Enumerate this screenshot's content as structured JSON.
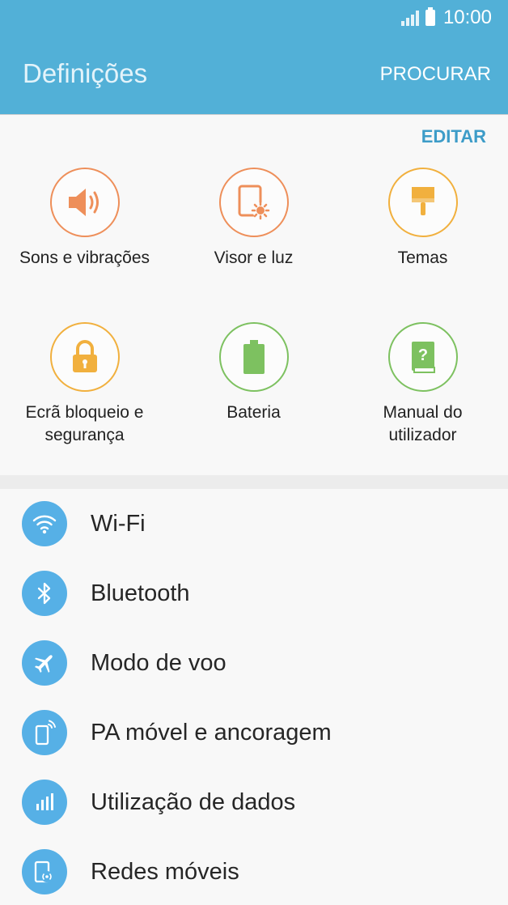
{
  "status_bar": {
    "time": "10:00"
  },
  "header": {
    "title": "Definições",
    "search_label": "PROCURAR"
  },
  "quick_settings": {
    "edit_label": "EDITAR",
    "items": [
      {
        "label": "Sons e vibrações",
        "icon": "speaker-icon",
        "color": "#ee8f5a"
      },
      {
        "label": "Visor e luz",
        "icon": "display-icon",
        "color": "#ee8f5a"
      },
      {
        "label": "Temas",
        "icon": "paintbrush-icon",
        "color": "#f1b03e"
      },
      {
        "label": "Ecrã bloqueio e segurança",
        "icon": "lock-icon",
        "color": "#f1b03e"
      },
      {
        "label": "Bateria",
        "icon": "battery-icon",
        "color": "#7dc160"
      },
      {
        "label": "Manual do utilizador",
        "icon": "manual-icon",
        "color": "#7dc160"
      }
    ]
  },
  "settings_list": [
    {
      "label": "Wi-Fi",
      "icon": "wifi-icon"
    },
    {
      "label": "Bluetooth",
      "icon": "bluetooth-icon"
    },
    {
      "label": "Modo de voo",
      "icon": "airplane-icon"
    },
    {
      "label": "PA móvel e ancoragem",
      "icon": "hotspot-icon"
    },
    {
      "label": "Utilização de dados",
      "icon": "data-usage-icon"
    },
    {
      "label": "Redes móveis",
      "icon": "mobile-networks-icon"
    }
  ],
  "colors": {
    "app_bar": "#52b0d7",
    "accent": "#3d9cc8",
    "list_icon_bg": "#56b0e6"
  }
}
